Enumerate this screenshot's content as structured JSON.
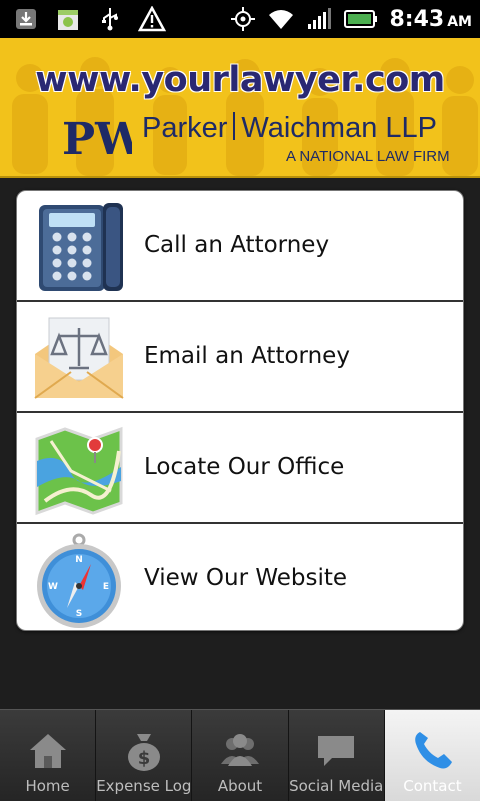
{
  "status_bar": {
    "time": "8:43",
    "ampm": "AM",
    "icons": [
      "download-icon",
      "android-market-icon",
      "usb-icon",
      "warning-icon",
      "gps-icon",
      "wifi-icon",
      "signal-icon",
      "battery-icon"
    ]
  },
  "banner": {
    "url": "www.yourlawyer.com",
    "logo_letters": "PW",
    "firm_first": "Parker",
    "firm_second": "Waichman LLP",
    "tagline": "A NATIONAL LAW FIRM",
    "bg_color": "#f2c21b",
    "text_color": "#1e2a66"
  },
  "menu": {
    "items": [
      {
        "label": "Call an Attorney",
        "icon": "phone-icon"
      },
      {
        "label": "Email an Attorney",
        "icon": "envelope-scales-icon"
      },
      {
        "label": "Locate Our Office",
        "icon": "map-icon"
      },
      {
        "label": "View Our Website",
        "icon": "compass-icon"
      }
    ]
  },
  "tabs": [
    {
      "label": "Home",
      "icon": "home-icon",
      "active": false
    },
    {
      "label": "Expense Log",
      "icon": "money-bag-icon",
      "active": false
    },
    {
      "label": "About",
      "icon": "people-icon",
      "active": false
    },
    {
      "label": "Social Media",
      "icon": "chat-bubble-icon",
      "active": false
    },
    {
      "label": "Contact",
      "icon": "phone-handset-icon",
      "active": true
    }
  ]
}
